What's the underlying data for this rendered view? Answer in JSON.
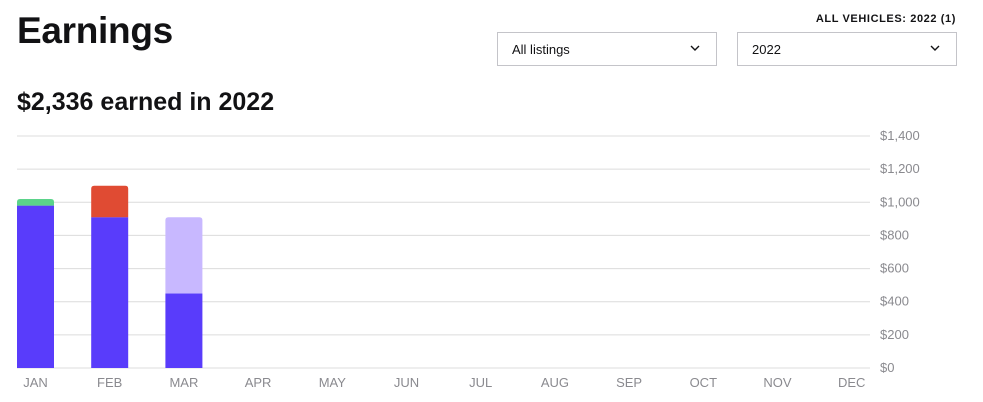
{
  "page": {
    "title": "Earnings",
    "vehicles_label": "ALL VEHICLES: 2022 (1)",
    "summary": "$2,336 earned in 2022"
  },
  "filters": {
    "listings": {
      "value": "All listings",
      "icon": "chevron-down-icon"
    },
    "year": {
      "value": "2022",
      "icon": "chevron-down-icon"
    }
  },
  "colors": {
    "primary": "#593cfb",
    "green": "#5bd38a",
    "red": "#e04b33",
    "lavender": "#c8b8ff",
    "grid": "#dcdcdc",
    "axis_text": "#8a8a8f"
  },
  "chart_data": {
    "type": "bar",
    "stacked": true,
    "categories": [
      "JAN",
      "FEB",
      "MAR",
      "APR",
      "MAY",
      "JUN",
      "JUL",
      "AUG",
      "SEP",
      "OCT",
      "NOV",
      "DEC"
    ],
    "series": [
      {
        "color": "#593cfb",
        "values": [
          980,
          910,
          450,
          0,
          0,
          0,
          0,
          0,
          0,
          0,
          0,
          0
        ]
      },
      {
        "color": "#5bd38a",
        "values": [
          40,
          0,
          0,
          0,
          0,
          0,
          0,
          0,
          0,
          0,
          0,
          0
        ]
      },
      {
        "color": "#e04b33",
        "values": [
          0,
          190,
          0,
          0,
          0,
          0,
          0,
          0,
          0,
          0,
          0,
          0
        ]
      },
      {
        "color": "#c8b8ff",
        "values": [
          0,
          0,
          460,
          0,
          0,
          0,
          0,
          0,
          0,
          0,
          0,
          0
        ]
      }
    ],
    "yticks": [
      "$0",
      "$200",
      "$400",
      "$600",
      "$800",
      "$1,000",
      "$1,200",
      "$1,400"
    ],
    "ylim": [
      0,
      1400
    ],
    "grid": true,
    "y_axis_position": "right"
  }
}
